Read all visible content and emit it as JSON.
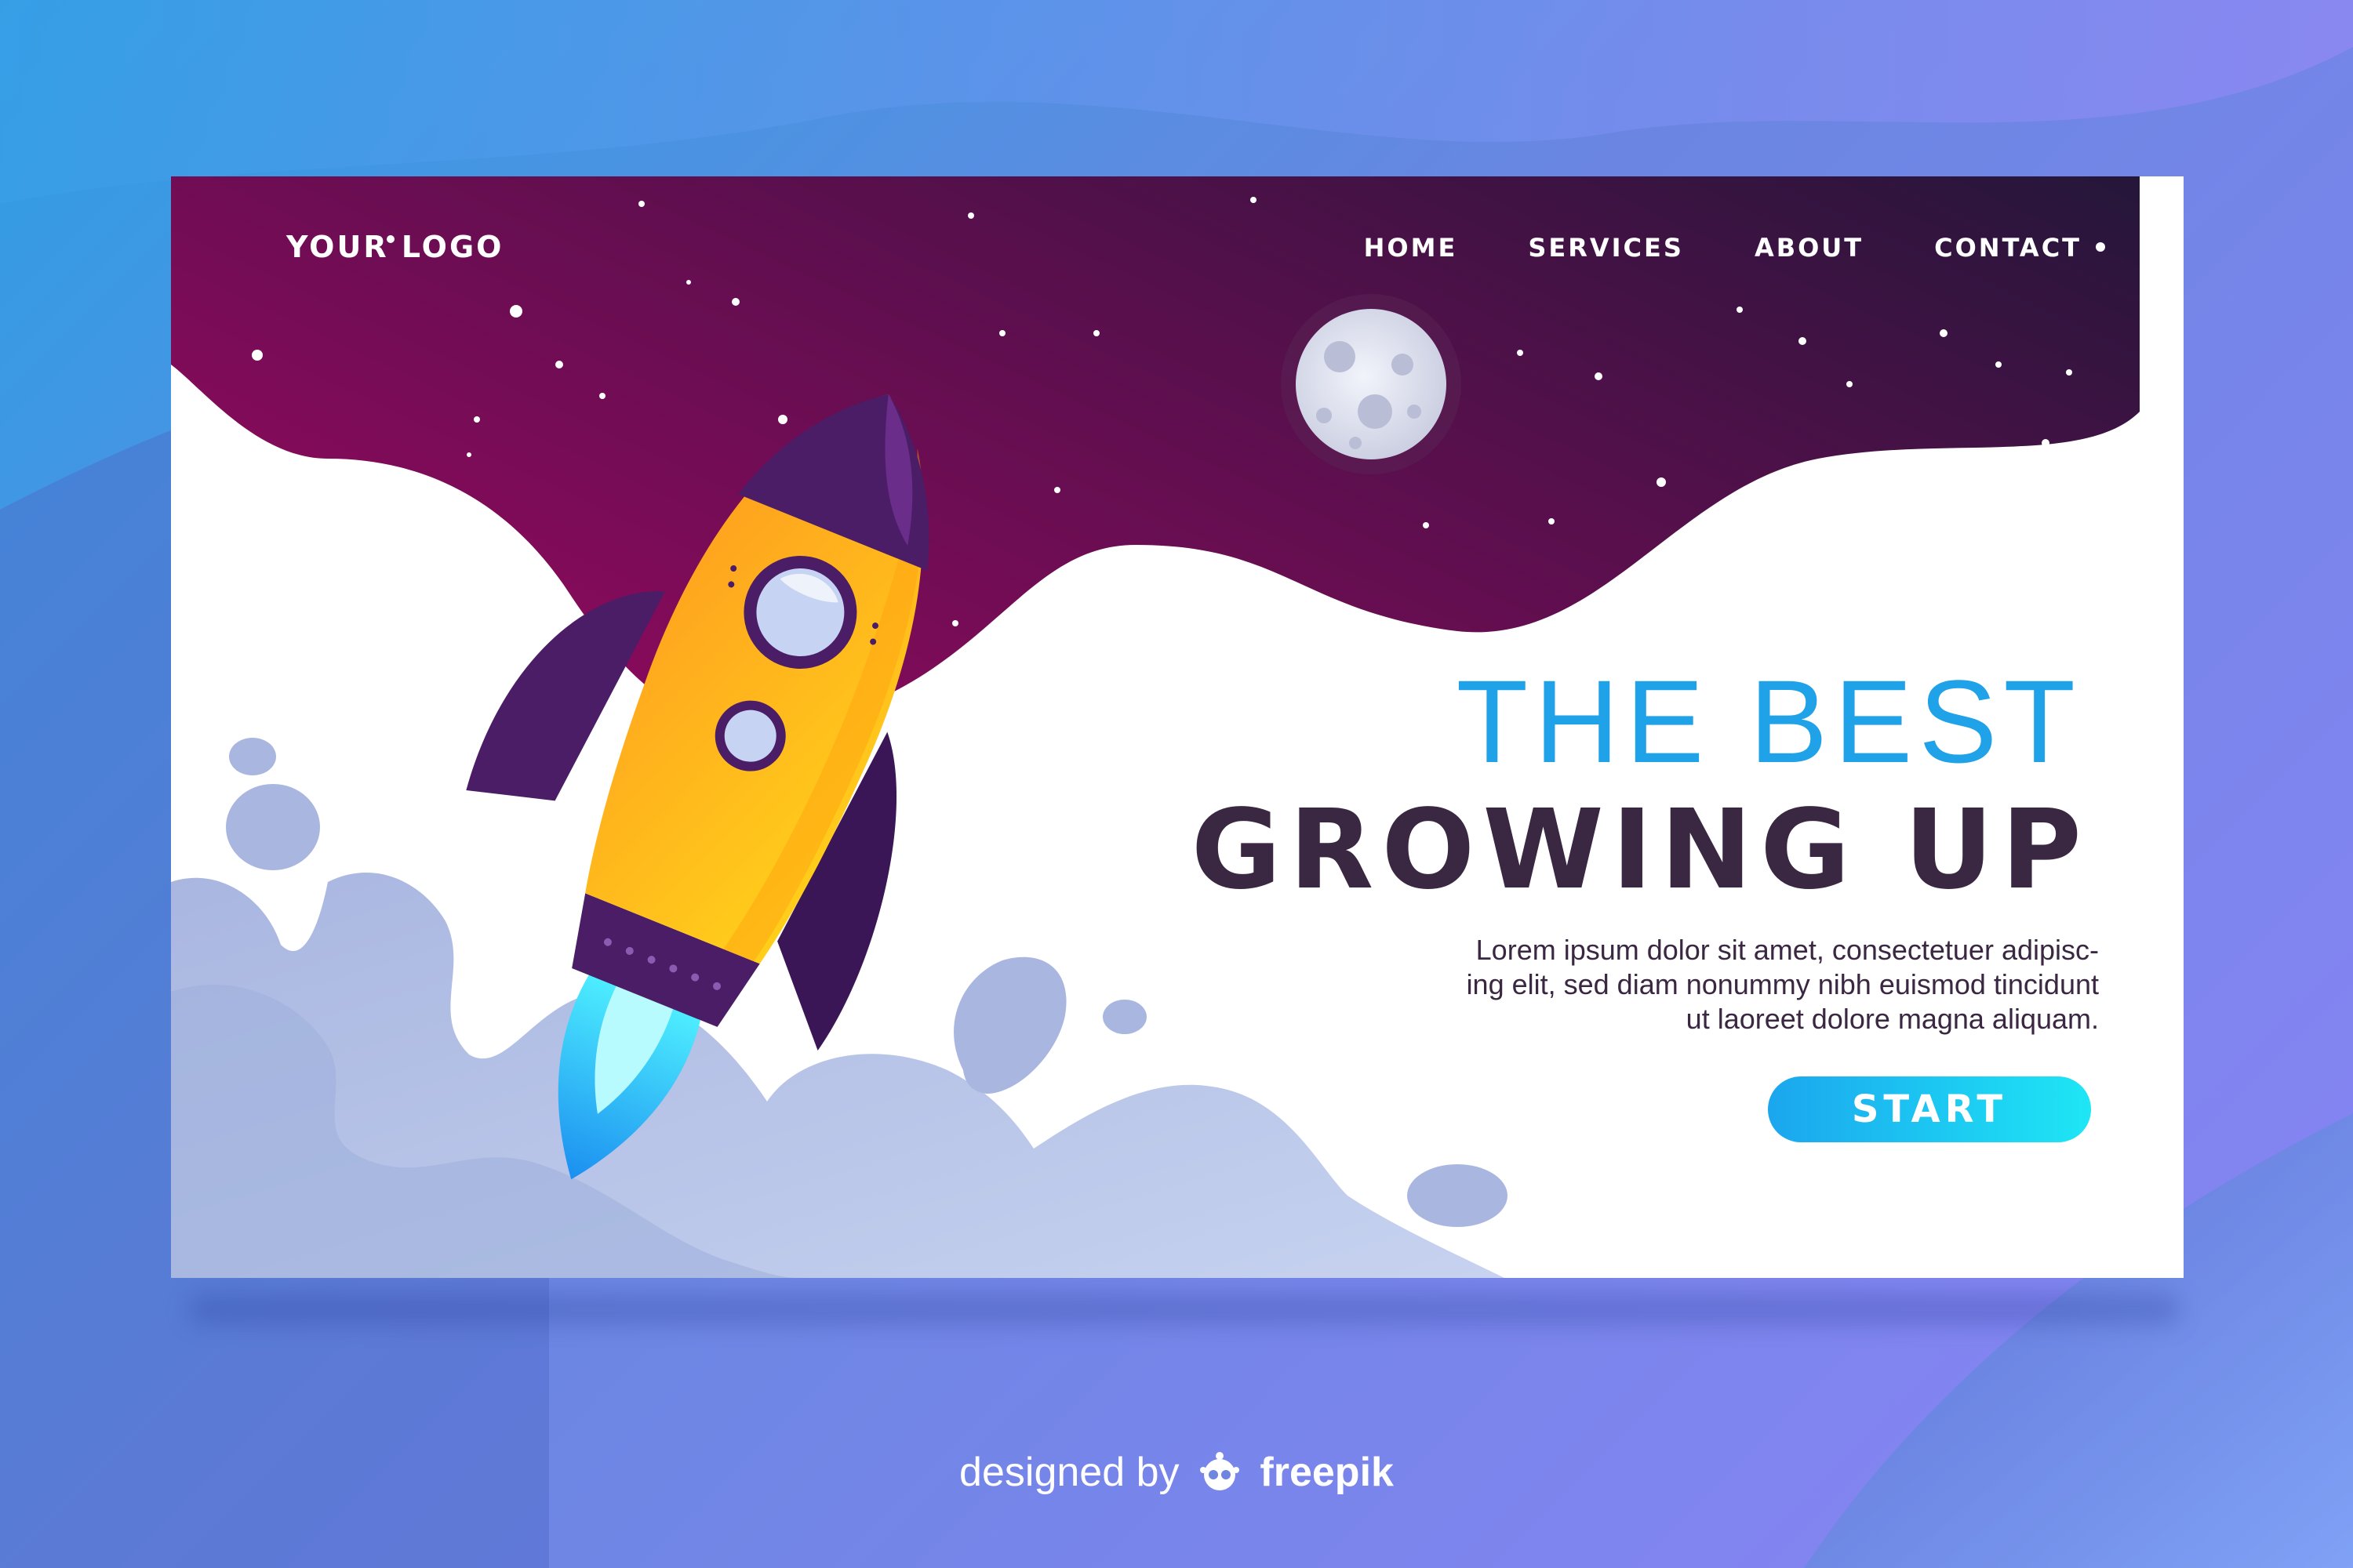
{
  "brand": {
    "logo": "YOUR LOGO"
  },
  "nav": {
    "items": [
      {
        "label": "HOME"
      },
      {
        "label": "SERVICES"
      },
      {
        "label": "ABOUT"
      },
      {
        "label": "CONTACT"
      }
    ]
  },
  "hero": {
    "line1": "THE BEST",
    "line2": "GROWING UP",
    "body": [
      "Lorem ipsum dolor sit amet, consectetuer adipisc-",
      "ing elit, sed diam nonummy nibh euismod tincidunt",
      "ut laoreet dolore magna aliquam."
    ],
    "cta": "START"
  },
  "footer": {
    "credit_prefix": "designed by",
    "credit_brand": "freepik"
  },
  "icons": [
    "rocket-icon",
    "moon-icon",
    "smoke-cloud",
    "freepik-mascot-icon"
  ],
  "colors": {
    "accent": "#1fa2e8",
    "heading": "#3a2741",
    "space_start": "#8a0a5c",
    "space_end": "#2a1640",
    "rocket": "#ffb300",
    "rocket_fins": "#4a1d66",
    "button_start": "#1ba6ee",
    "button_end": "#1ee6f5"
  }
}
